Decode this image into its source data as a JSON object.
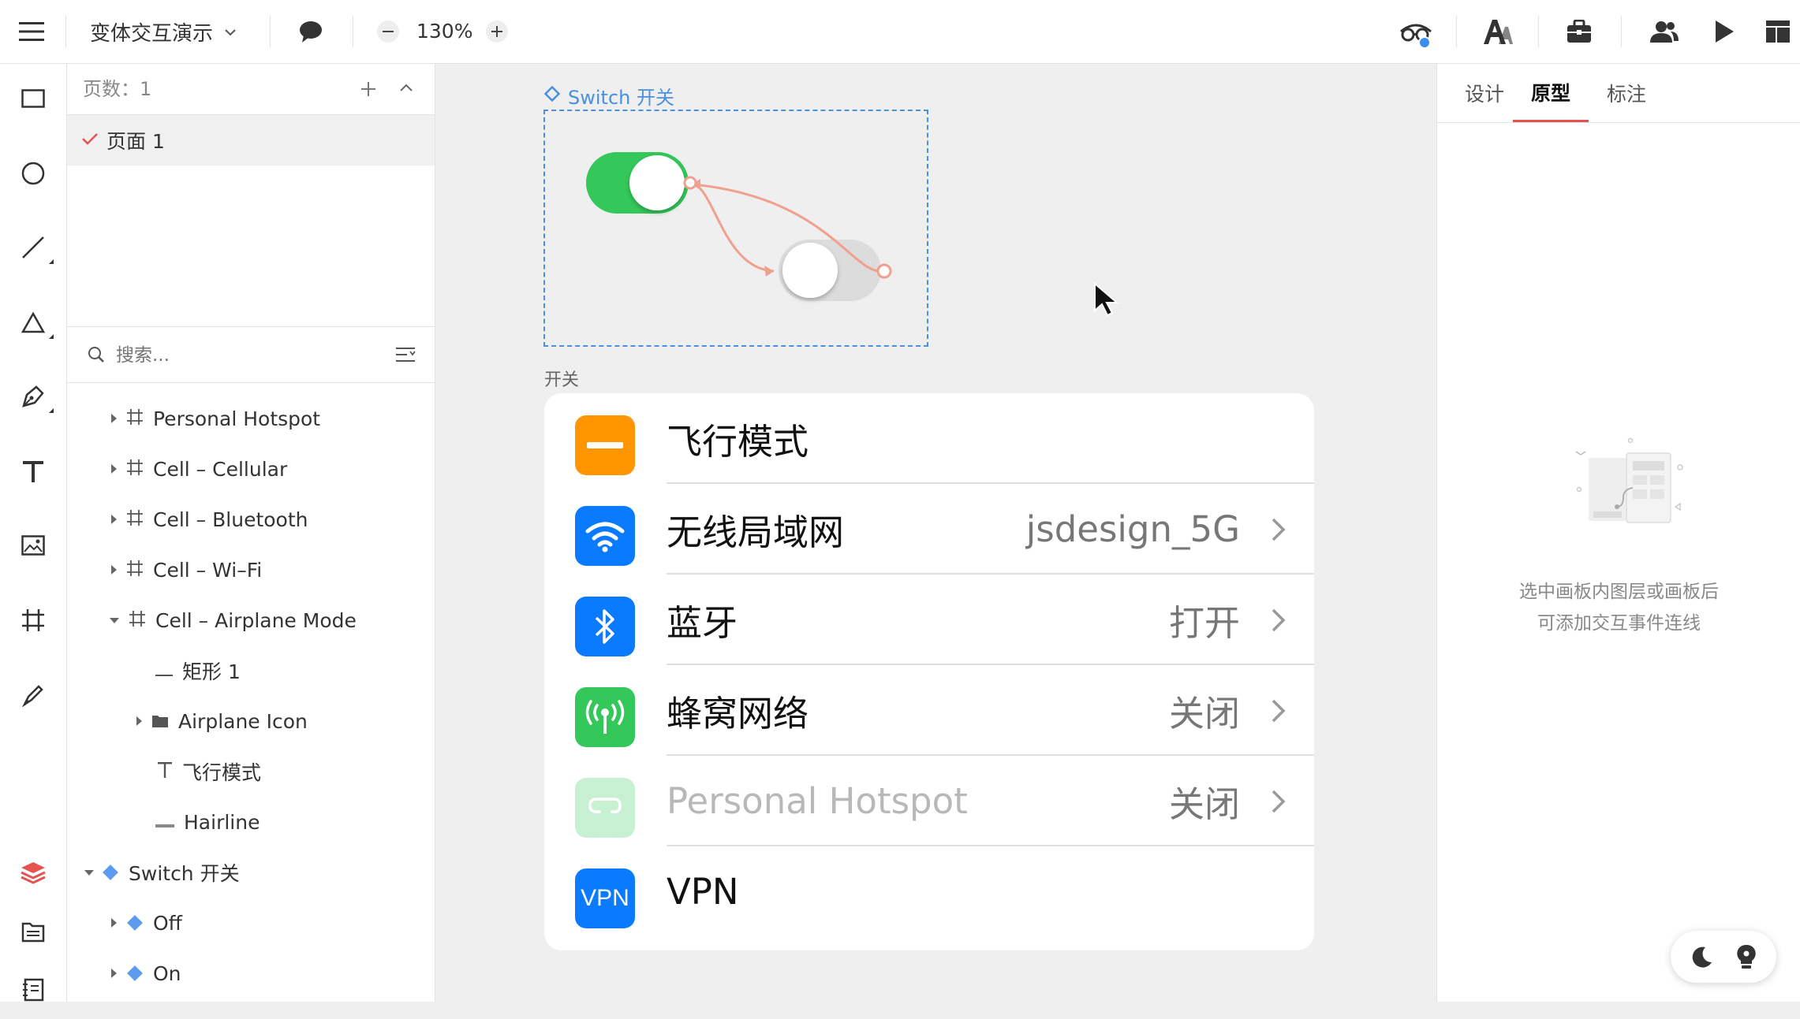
{
  "topbar": {
    "file_name": "变体交互演示",
    "zoom": "130%"
  },
  "layers_panel": {
    "page_count_label": "页数：1",
    "current_page": "页面 1",
    "search_placeholder": "搜索...",
    "items": [
      {
        "label": "Personal Hotspot"
      },
      {
        "label": "Cell – Cellular"
      },
      {
        "label": "Cell – Bluetooth"
      },
      {
        "label": "Cell – Wi–Fi"
      },
      {
        "label": "Cell – Airplane Mode"
      },
      {
        "label": "矩形 1"
      },
      {
        "label": "Airplane Icon"
      },
      {
        "label": "飞行模式"
      },
      {
        "label": "Hairline"
      },
      {
        "label": "Switch 开关"
      },
      {
        "label": "Off"
      },
      {
        "label": "On"
      }
    ]
  },
  "canvas": {
    "component_label": "Switch 开关",
    "frame_label": "开关",
    "cells": [
      {
        "label": "飞行模式",
        "value": ""
      },
      {
        "label": "无线局域网",
        "value": "jsdesign_5G"
      },
      {
        "label": "蓝牙",
        "value": "打开"
      },
      {
        "label": "蜂窝网络",
        "value": "关闭"
      },
      {
        "label": "Personal Hotspot",
        "value": "关闭"
      },
      {
        "label": "VPN",
        "value": ""
      }
    ],
    "vpn_icon_text": "VPN"
  },
  "right_panel": {
    "tabs": [
      {
        "label": "设计"
      },
      {
        "label": "原型"
      },
      {
        "label": "标注"
      }
    ],
    "empty_hint_line1": "选中画板内图层或画板后",
    "empty_hint_line2": "可添加交互事件连线"
  },
  "colors": {
    "accent_red": "#e4534f",
    "switch_green": "#34c759",
    "selection_blue": "#4a90e2",
    "airplane_orange": "#ff9500",
    "ios_blue": "#0a7aff",
    "cellular_green": "#34c759",
    "hotspot_green_faded": "#c8f0d2"
  }
}
